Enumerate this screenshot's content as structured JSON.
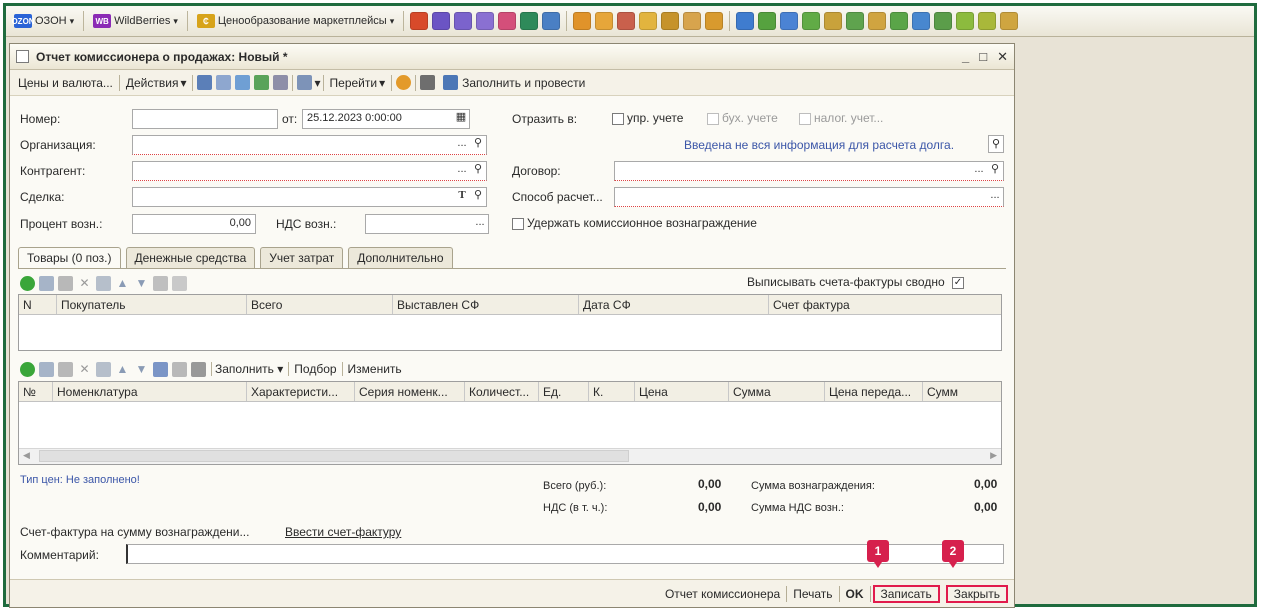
{
  "topbar": {
    "items": [
      {
        "label": "ОЗОН",
        "logo": "OZON",
        "color": "#2a63d6"
      },
      {
        "label": "WildBerries",
        "logo": "WB",
        "color": "#8b2bb5"
      },
      {
        "label": "Ценообразование маркетплейсы",
        "logo": "₵",
        "color": "#d7a31a"
      }
    ]
  },
  "window": {
    "title": "Отчет комиссионера о продажах: Новый *",
    "minimize": "_",
    "maximize": "□",
    "close": "✕"
  },
  "commandbar": {
    "prices": "Цены и валюта...",
    "actions": "Действия",
    "goto": "Перейти",
    "fill_post": "Заполнить и провести"
  },
  "form": {
    "number_label": "Номер:",
    "number_value": "",
    "from_label": "от:",
    "date_value": "25.12.2023 0:00:00",
    "reflect_label": "Отразить в:",
    "mgmt_label": "упр. учете",
    "acct_label": "бух. учете",
    "tax_label": "налог. учет...",
    "org_label": "Организация:",
    "debt_info": "Введена не вся информация для расчета долга.",
    "contractor_label": "Контрагент:",
    "contract_label": "Договор:",
    "deal_label": "Сделка:",
    "payment_label": "Способ расчет...",
    "percent_label": "Процент возн.:",
    "percent_value": "0,00",
    "vat_label": "НДС возн.:",
    "withhold_label": "Удержать комиссионное вознаграждение"
  },
  "tabs": [
    {
      "label": "Товары (0 поз.)"
    },
    {
      "label": "Денежные средства"
    },
    {
      "label": "Учет затрат"
    },
    {
      "label": "Дополнительно"
    }
  ],
  "invoices_summary_label": "Выписывать счета-фактуры сводно",
  "grid1": {
    "columns": [
      "N",
      "Покупатель",
      "Всего",
      "Выставлен СФ",
      "Дата СФ",
      "Счет фактура"
    ]
  },
  "grid2_toolbar": {
    "fill": "Заполнить",
    "select": "Подбор",
    "change": "Изменить"
  },
  "grid2": {
    "columns": [
      "№",
      "Номенклатура",
      "Характеристи...",
      "Серия номенк...",
      "Количест...",
      "Ед.",
      "К.",
      "Цена",
      "Сумма",
      "Цена переда...",
      "Сумм"
    ]
  },
  "footer": {
    "price_type": "Тип цен: Не заполнено!",
    "total_label": "Всего (руб.):",
    "total_value": "0,00",
    "vat_total_label": "НДС (в т. ч.):",
    "vat_total_value": "0,00",
    "reward_label": "Сумма вознаграждения:",
    "reward_value": "0,00",
    "reward_vat_label": "Сумма НДС возн.:",
    "reward_vat_value": "0,00",
    "invoice_label": "Счет-фактура на сумму вознаграждени...",
    "invoice_link": "Ввести счет-фактуру",
    "comment_label": "Комментарий:",
    "comment_value": ""
  },
  "buttons": {
    "report": "Отчет комиссионера",
    "print": "Печать",
    "ok": "OK",
    "save": "Записать",
    "close": "Закрыть"
  },
  "badges": [
    "1",
    "2"
  ],
  "colors": {
    "highlight": "#e11b4c",
    "frame": "#1f6b3e",
    "link": "#3b56a8"
  }
}
